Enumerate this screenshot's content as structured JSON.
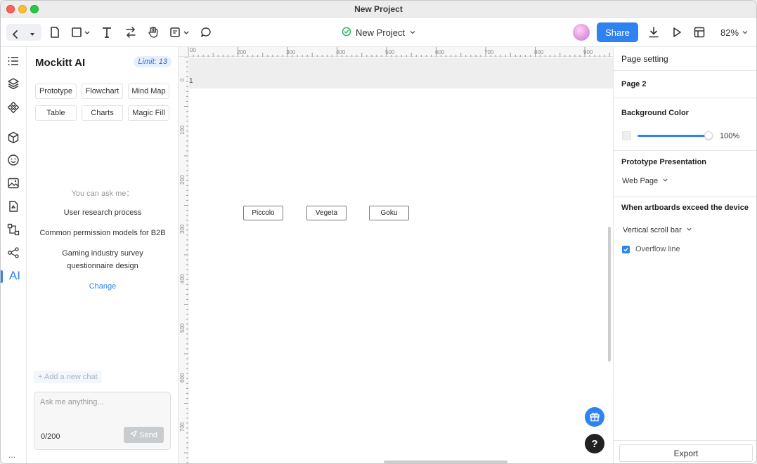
{
  "window": {
    "title": "New Project"
  },
  "toolbar": {
    "doc_title": "New Project",
    "share_label": "Share",
    "zoom": "82%",
    "icons": [
      "back-icon",
      "dropdown-icon",
      "page-icon",
      "rectangle-icon",
      "text-icon",
      "interaction-icon",
      "hand-icon",
      "note-icon",
      "comment-icon",
      "avatar",
      "download-icon",
      "play-icon",
      "layout-icon"
    ]
  },
  "rail": {
    "items": [
      "outline-icon",
      "layers-icon",
      "components-icon",
      "widgets-icon",
      "emoji-icon",
      "image-icon",
      "asset-icon",
      "flow-icon",
      "mindmap-icon"
    ],
    "ai_label": "AI",
    "more": "..."
  },
  "ai_panel": {
    "title": "Mockitt AI",
    "limit": "Limit: 13",
    "chips": [
      "Prototype",
      "Flowchart",
      "Mind Map",
      "Table",
      "Charts",
      "Magic Fill"
    ],
    "ask_label": "You can ask me：",
    "suggestions": [
      "User research process",
      "Common permission models for B2B",
      "Gaming industry survey questionnaire design"
    ],
    "change_label": "Change",
    "new_chat_label": "+ Add a new chat",
    "input_placeholder": "Ask me anything...",
    "char_counter": "0/200",
    "send_label": "Send"
  },
  "canvas": {
    "ruler_top": [
      "00",
      "200",
      "300",
      "400",
      "500",
      "600",
      "700",
      "800",
      "900"
    ],
    "ruler_left": [
      "0",
      "100",
      "200",
      "300",
      "400",
      "500",
      "600",
      "700"
    ],
    "page_index": "1",
    "boxes": [
      "Piccolo",
      "Vegeta",
      "Goku"
    ],
    "help_label": "?"
  },
  "right_panel": {
    "header": "Page setting",
    "page_name": "Page 2",
    "background_color_label": "Background Color",
    "opacity": "100%",
    "prototype_presentation_label": "Prototype Presentation",
    "presentation_value": "Web Page",
    "exceed_label": "When artboards exceed the device",
    "exceed_value": "Vertical scroll bar",
    "overflow_line_label": "Overflow line",
    "overflow_line_checked": true,
    "export_label": "Export"
  },
  "colors": {
    "accent": "#2f83f0",
    "success": "#2fb56a"
  }
}
